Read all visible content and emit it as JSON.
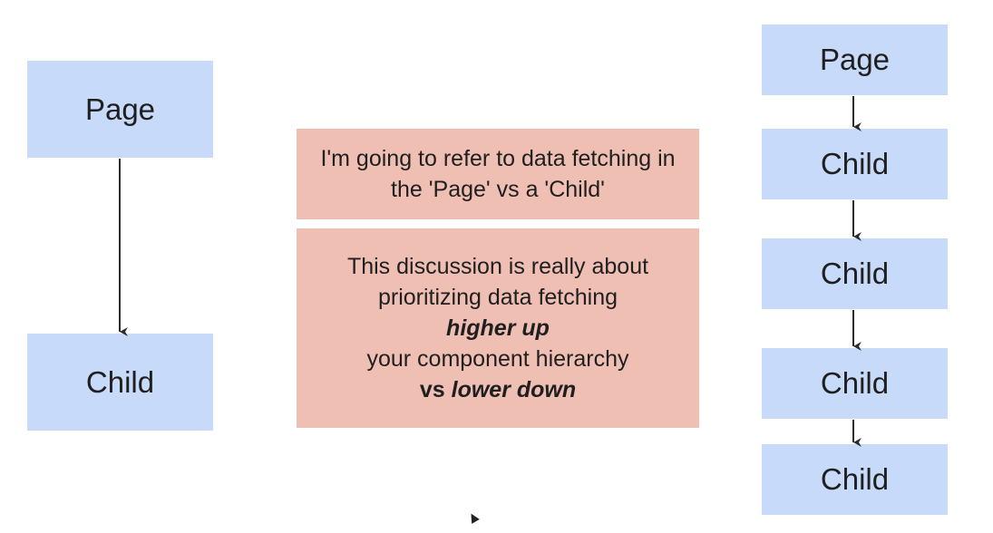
{
  "left_diagram": {
    "page_label": "Page",
    "child_label": "Child"
  },
  "notes": {
    "note1": {
      "line1": "I'm going to refer to data fetching in",
      "line2": "the 'Page' vs a 'Child'"
    },
    "note2": {
      "line1": "This discussion is really about",
      "line2": "prioritizing data fetching",
      "line3": "higher up",
      "line4": "your component hierarchy",
      "line5_bold": "vs",
      "line5_bold_italic": "lower down"
    }
  },
  "right_diagram": {
    "page_label": "Page",
    "children": [
      "Child",
      "Child",
      "Child",
      "Child"
    ]
  },
  "colors": {
    "node_fill": "#c8daf9",
    "note_fill": "#efbfb4",
    "arrow": "#2b2b2b"
  }
}
